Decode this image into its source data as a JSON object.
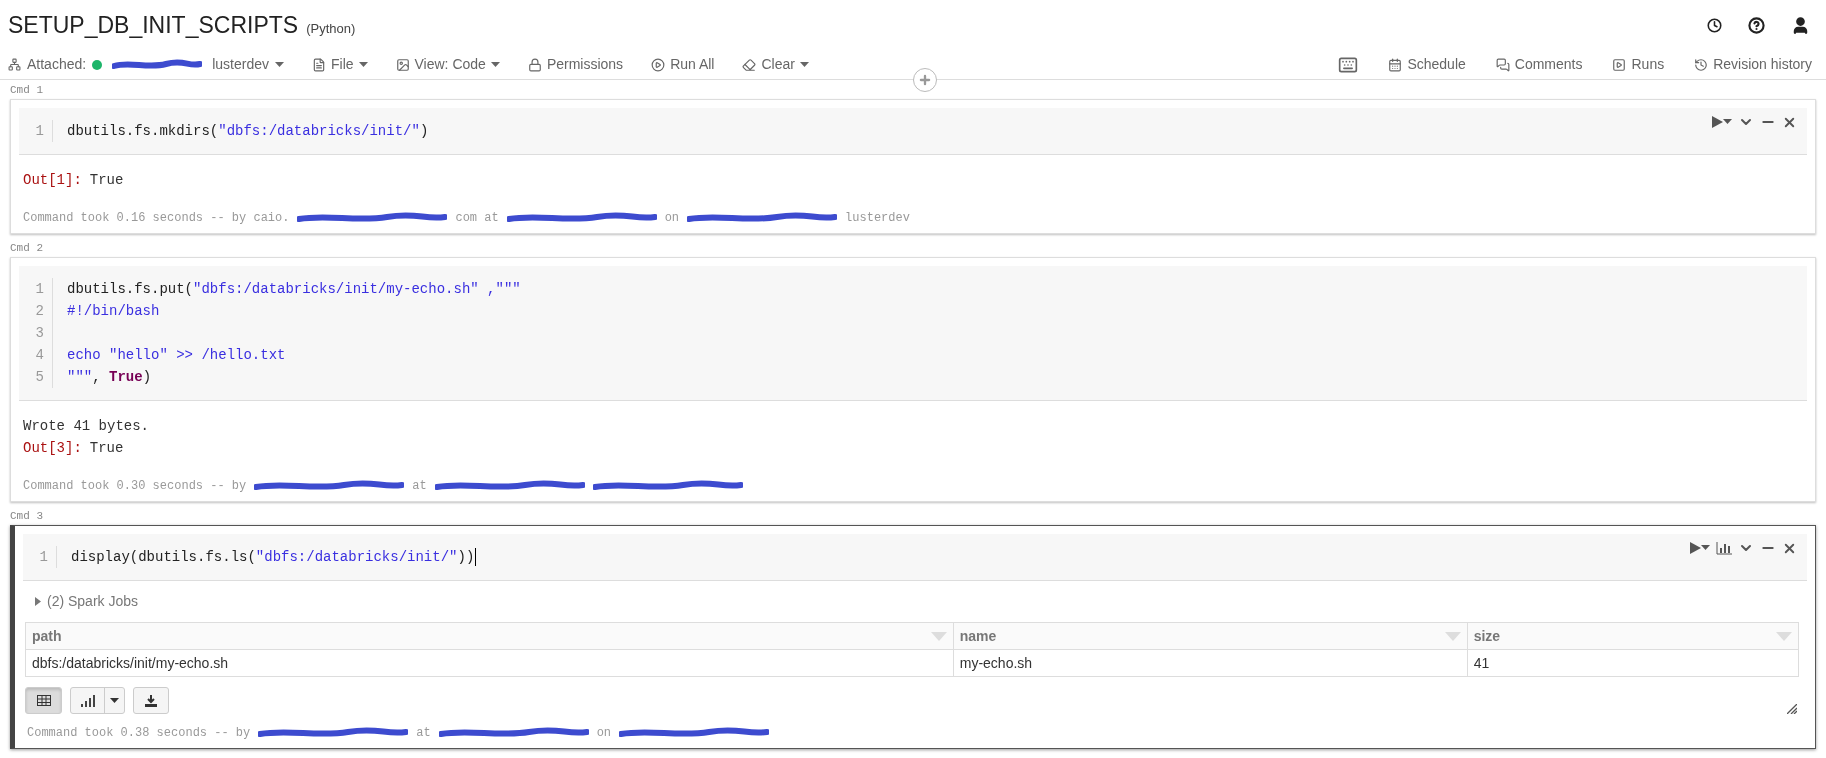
{
  "title": "SETUP_DB_INIT_SCRIPTS",
  "language": "(Python)",
  "attached": {
    "label": "Attached:",
    "connected": true,
    "cluster": [
      {
        "kind": "redaction"
      },
      {
        "kind": "text",
        "text": "lusterdev"
      }
    ]
  },
  "menus": [
    {
      "kind": "file",
      "label": "File",
      "dropdown": true
    },
    {
      "kind": "image",
      "label": "View: Code",
      "dropdown": true
    },
    {
      "kind": "lock",
      "label": "Permissions",
      "dropdown": false
    },
    {
      "kind": "run",
      "label": "Run All",
      "dropdown": false
    },
    {
      "kind": "eraser",
      "label": "Clear",
      "dropdown": true
    }
  ],
  "right_menus": [
    {
      "kind": "keyboard"
    },
    {
      "kind": "calendar",
      "label": "Schedule"
    },
    {
      "kind": "comments",
      "label": "Comments"
    },
    {
      "kind": "runs",
      "label": "Runs"
    },
    {
      "kind": "history",
      "label": "Revision history"
    }
  ],
  "cells": [
    {
      "label": "Cmd 1",
      "selected": false,
      "cursor": false,
      "actions": [
        {
          "kind": "run"
        },
        {
          "kind": "expand"
        },
        {
          "kind": "minimize"
        },
        {
          "kind": "close"
        }
      ],
      "lines": [
        {
          "number": "1",
          "tokens": [
            {
              "kind": "plain",
              "text": "dbutils.fs.mkdirs("
            },
            {
              "kind": "string",
              "text": "\"dbfs:/databricks/init/\""
            },
            {
              "kind": "plain",
              "text": ")"
            }
          ]
        }
      ],
      "outputs": [
        {
          "kind": "out",
          "prompt": "Out[1]:",
          "text": "True"
        }
      ],
      "footer": [
        {
          "kind": "text",
          "text": "Command took 0.16 seconds -- by caio."
        },
        {
          "kind": "redaction"
        },
        {
          "kind": "text",
          "text": "com at"
        },
        {
          "kind": "redaction"
        },
        {
          "kind": "text",
          "text": "on"
        },
        {
          "kind": "redaction"
        },
        {
          "kind": "text",
          "text": "lusterdev"
        }
      ]
    },
    {
      "label": "Cmd 2",
      "selected": false,
      "cursor": false,
      "lines": [
        {
          "number": "1",
          "tokens": [
            {
              "kind": "plain",
              "text": "dbutils.fs.put("
            },
            {
              "kind": "string",
              "text": "\"dbfs:/databricks/init/my-echo.sh\""
            },
            {
              "kind": "string",
              "text": " ,\"\"\""
            }
          ]
        },
        {
          "number": "2",
          "tokens": [
            {
              "kind": "string",
              "text": "#!/bin/bash"
            }
          ]
        },
        {
          "number": "3"
        },
        {
          "number": "4",
          "tokens": [
            {
              "kind": "string",
              "text": "echo \"hello\" >> /hello.txt"
            }
          ]
        },
        {
          "number": "5",
          "tokens": [
            {
              "kind": "string",
              "text": "\"\"\""
            },
            {
              "kind": "plain",
              "text": ", "
            },
            {
              "kind": "keyword",
              "text": "True"
            },
            {
              "kind": "plain",
              "text": ")"
            }
          ]
        }
      ],
      "outputs": [
        {
          "kind": "text",
          "text": "Wrote 41 bytes."
        },
        {
          "kind": "out",
          "prompt": "Out[3]:",
          "text": "True"
        }
      ],
      "footer": [
        {
          "kind": "text",
          "text": "Command took 0.30 seconds -- by"
        },
        {
          "kind": "redaction"
        },
        {
          "kind": "text",
          "text": "at"
        },
        {
          "kind": "redaction"
        },
        {
          "kind": "redaction"
        }
      ]
    },
    {
      "label": "Cmd 3",
      "selected": true,
      "cursor": true,
      "actions": [
        {
          "kind": "run"
        },
        {
          "kind": "chart"
        },
        {
          "kind": "expand"
        },
        {
          "kind": "minimize"
        },
        {
          "kind": "close"
        }
      ],
      "lines": [
        {
          "number": "1",
          "tokens": [
            {
              "kind": "plain",
              "text": "display(dbutils.fs.ls("
            },
            {
              "kind": "string",
              "text": "\"dbfs:/databricks/init/\""
            },
            {
              "kind": "plain",
              "text": "))"
            }
          ]
        }
      ],
      "spark_jobs": {
        "label": "(2) Spark Jobs",
        "expanded": false
      },
      "table": {
        "columns": [
          "path",
          "name",
          "size"
        ],
        "rows": [
          [
            "dbfs:/databricks/init/my-echo.sh",
            "my-echo.sh",
            "41"
          ]
        ]
      },
      "view_buttons": [
        {
          "kind": "table",
          "selected": true
        },
        {
          "kind": "chart",
          "selected": false
        },
        {
          "kind": "download",
          "selected": false
        }
      ],
      "footer": [
        {
          "kind": "text",
          "text": "Command took 0.38 seconds -- by"
        },
        {
          "kind": "redaction"
        },
        {
          "kind": "text",
          "text": "at"
        },
        {
          "kind": "redaction"
        },
        {
          "kind": "text",
          "text": "on"
        },
        {
          "kind": "redaction"
        }
      ]
    }
  ]
}
